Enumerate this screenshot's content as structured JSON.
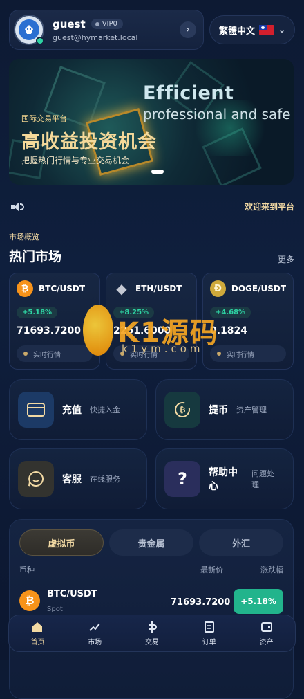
{
  "user": {
    "name": "guest",
    "vip": "VIP0",
    "email": "guest@hymarket.local"
  },
  "language": {
    "label": "繁體中文"
  },
  "banner": {
    "eyebrow": "国际交易平台",
    "title": "高收益投资机会",
    "desc": "把握热门行情与专业交易机会",
    "en_title": "Efficient",
    "en_sub": "professional and safe"
  },
  "notice": {
    "text": "欢迎来到平台"
  },
  "market": {
    "subtitle": "市场概览",
    "title": "热门市场",
    "more": "更多",
    "cards": [
      {
        "symbol": "BTC/USDT",
        "change": "+5.18%",
        "price": "71693.7200",
        "tag": "实时行情",
        "icon": "btc-icon"
      },
      {
        "symbol": "ETH/USDT",
        "change": "+8.25%",
        "price": "2251.6000",
        "tag": "实时行情",
        "icon": "eth-icon"
      },
      {
        "symbol": "DOGE/USDT",
        "change": "+4.68%",
        "price": "0.1824",
        "tag": "实时行情",
        "icon": "doge-icon"
      }
    ]
  },
  "watermark": {
    "text": "K1源码",
    "url": "k1ym.com"
  },
  "actions": [
    {
      "label": "充值",
      "sub": "快捷入金"
    },
    {
      "label": "提币",
      "sub": "资产管理"
    },
    {
      "label": "客服",
      "sub": "在线服务"
    },
    {
      "label": "帮助中心",
      "sub": "问题处理"
    }
  ],
  "list": {
    "tabs": [
      "虚拟币",
      "贵金属",
      "外汇"
    ],
    "columns": {
      "coin": "币种",
      "price": "最新价",
      "change": "涨跌幅"
    },
    "rows": [
      {
        "name": "BTC/USDT",
        "sub": "Spot",
        "price": "71693.7200",
        "change": "+5.18%"
      }
    ]
  },
  "nav": [
    "首页",
    "市场",
    "交易",
    "订单",
    "资产"
  ],
  "colors": {
    "accent_gold": "#f2d9a3",
    "up_green": "#2ed3a3",
    "bg": "#0d1a33"
  }
}
